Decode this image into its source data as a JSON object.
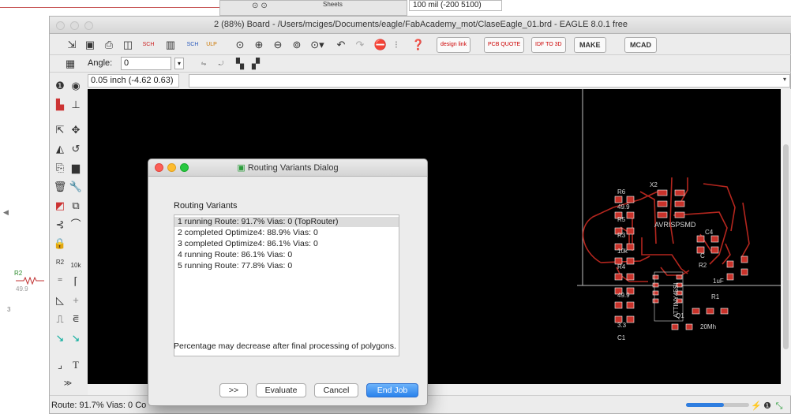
{
  "background": {
    "sheets_title": "Sheets",
    "coord_readout": "100 mil (-200 5100)",
    "resistor_label": "R2",
    "resistor_value": "49.9",
    "side_number": "3"
  },
  "window": {
    "title": "2 (88%) Board - /Users/mciges/Documents/eagle/FabAcademy_mot/ClaseEagle_01.brd - EAGLE 8.0.1 free"
  },
  "toolbar": {
    "sch_label": "SCH",
    "ulp_label": "ULP",
    "design_link_label": "design link",
    "pcb_quote_label": "PCB QUOTE",
    "idf_label": "IDF TO 3D",
    "make_label": "MAKE",
    "mcad_label": "MCAD"
  },
  "toolbar2": {
    "angle_label": "Angle:",
    "angle_value": "0"
  },
  "coord_display": "0.05 inch (-4.62 0.63)",
  "board": {
    "labels": {
      "r6": "R6",
      "r6_val": "49.9",
      "r5": "R5",
      "r3": "R3",
      "r4": "R4",
      "x2": "X2",
      "avr": "AVRISPSMD",
      "c4": "C4",
      "c": "C",
      "r2": "R2",
      "val499": "49.9",
      "val10k": "10k",
      "ic": "ATTINY45SI",
      "val1uf": "1uF",
      "mhz": "20Mh",
      "val33": "3.3",
      "q1": "Q1",
      "c1": "C1",
      "r1": "R1"
    }
  },
  "dialog": {
    "title": "Routing Variants Dialog",
    "section_label": "Routing Variants",
    "variants": [
      "1 running Route:  91.7%  Vias: 0 (TopRouter)",
      "2 completed Optimize4:  88.9%  Vias: 0",
      "3 completed Optimize4:  86.1%  Vias: 0",
      "4 running Route:  86.1%  Vias: 0",
      "5 running Route:  77.8%  Vias: 0"
    ],
    "note": "Percentage may decrease after final processing of polygons.",
    "buttons": {
      "expand": ">>",
      "evaluate": "Evaluate",
      "cancel": "Cancel",
      "end_job": "End Job"
    }
  },
  "status": {
    "text": "Route: 91.7% Vias: 0 Co",
    "progress": 0.6
  },
  "colors": {
    "trace": "#b4261e",
    "pad": "#c8322a",
    "board_outline": "#bfbfbf",
    "selection": "#dcdcdc",
    "primary_button": "#2a82ec"
  }
}
